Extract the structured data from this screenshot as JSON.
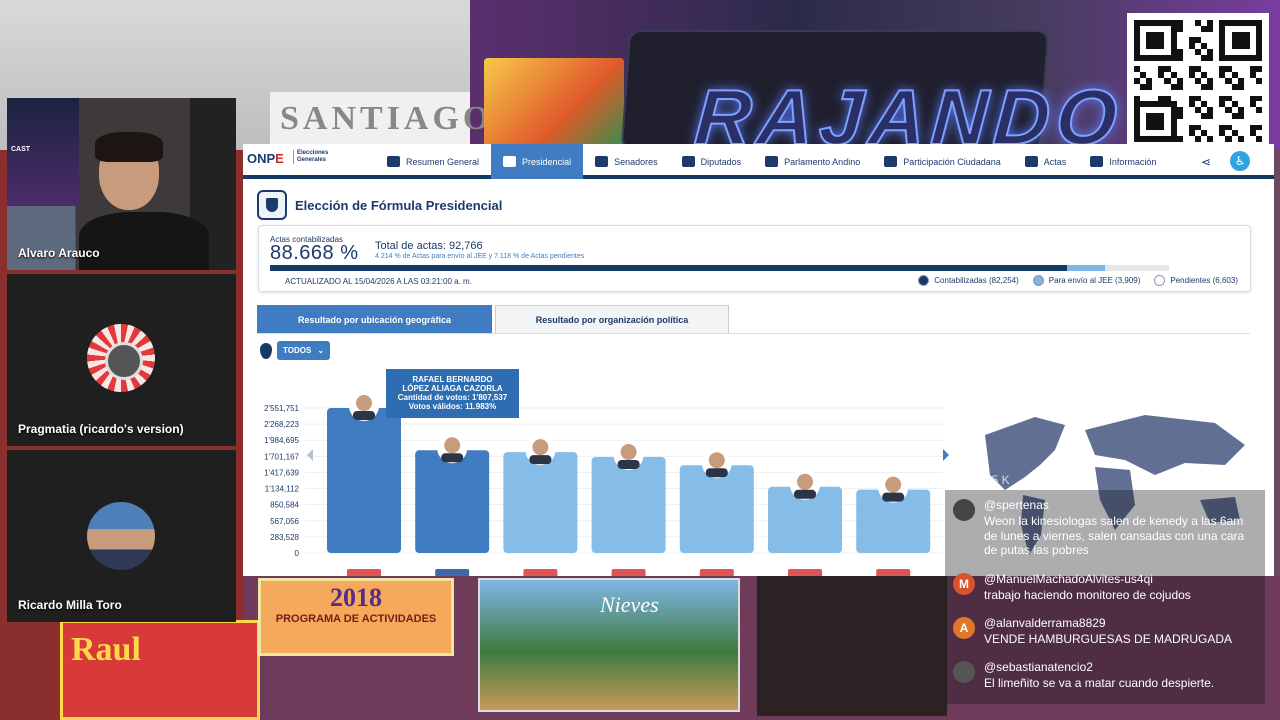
{
  "participants": [
    {
      "name": "Alvaro Arauco",
      "podcast_text": "CAST"
    },
    {
      "name": "Pragmatia (ricardo's version)"
    },
    {
      "name": "Ricardo Milla Toro"
    }
  ],
  "background": {
    "neon_sign": "RAJANDO",
    "wall_sign": "SANTIAGO",
    "poster_2018_year": "2018",
    "poster_2018_text": "PROGRAMA DE ACTIVIDADES",
    "poster_raul": "Raul",
    "poster_nieves": "Nieves"
  },
  "onpe": {
    "logo": {
      "mark_a": "ONP",
      "mark_b": "E",
      "sub": "Elecciones Generales"
    },
    "nav": [
      {
        "label": "Resumen General",
        "icon": "grid-icon"
      },
      {
        "label": "Presidencial",
        "icon": "seal-icon",
        "active": true
      },
      {
        "label": "Senadores",
        "icon": "people-icon"
      },
      {
        "label": "Diputados",
        "icon": "building-icon"
      },
      {
        "label": "Parlamento Andino",
        "icon": "map-icon"
      },
      {
        "label": "Participación Ciudadana",
        "icon": "group-icon"
      },
      {
        "label": "Actas",
        "icon": "checkbox-icon"
      },
      {
        "label": "Información",
        "icon": "document-icon"
      }
    ],
    "title": "Elección de Fórmula Presidencial",
    "progress": {
      "label": "Actas contabilizadas",
      "percent": "88.668 %",
      "total": "Total de actas: 92,766",
      "sub": "4.214 % de Actas para envío al JEE y 7.118 % de Actas pendientes",
      "updated": "ACTUALIZADO AL 15/04/2026 A LAS 03:21:00 a. m.",
      "fraction_counted": 0.88668,
      "fraction_jee": 0.04214,
      "legend": [
        {
          "label": "Contabilizadas (82,254)",
          "color": "#163a66"
        },
        {
          "label": "Para envío al JEE (3,909)",
          "color": "#7fb6e6"
        },
        {
          "label": "Pendientes (6,603)",
          "color": "#ffffff"
        }
      ]
    },
    "tabs": {
      "geo": "Resultado por ubicación geográfica",
      "org": "Resultado por organización política"
    },
    "filter": "TODOS",
    "tooltip": {
      "name": "RAFAEL BERNARDO LÓPEZ ALIAGA CAZORLA",
      "votes": "Cantidad de votos: 1'807,537",
      "valid": "Votos válidos: 11.983%"
    }
  },
  "chart_data": {
    "type": "bar",
    "yticks": [
      "2'551,751",
      "2'268,223",
      "1'984,695",
      "1'701,167",
      "1'417,639",
      "1'134,112",
      "850,584",
      "567,056",
      "283,528",
      "0"
    ],
    "ylim": [
      0,
      2551751
    ],
    "series": [
      {
        "values": [
          2551751,
          1807537,
          1775000,
          1690000,
          1545000,
          1165000,
          1115000
        ]
      }
    ],
    "bar_colors": [
      "#3f7cc2",
      "#3f7cc2",
      "#86bde8",
      "#86bde8",
      "#86bde8",
      "#86bde8",
      "#86bde8"
    ]
  },
  "chat": {
    "viewers": "15 K",
    "messages": [
      {
        "user": "@spertenas",
        "text": "Weon la kinesiologas salen de kenedy a las 6am de lunes a viernes, salen cansadas con una cara de putas las pobres",
        "initial": "",
        "color": "#444"
      },
      {
        "user": "@ManuelMachadoAlvites-us4qi",
        "text": "trabajo haciendo monitoreo de cojudos",
        "initial": "M",
        "color": "#d9542b"
      },
      {
        "user": "@alanvalderrama8829",
        "text": "VENDE HAMBURGUESAS DE MADRUGADA",
        "initial": "A",
        "color": "#e0772b"
      },
      {
        "user": "@sebastianatencio2",
        "text": "El limeñito se va a matar cuando despierte.",
        "initial": "",
        "color": "#555"
      }
    ]
  }
}
